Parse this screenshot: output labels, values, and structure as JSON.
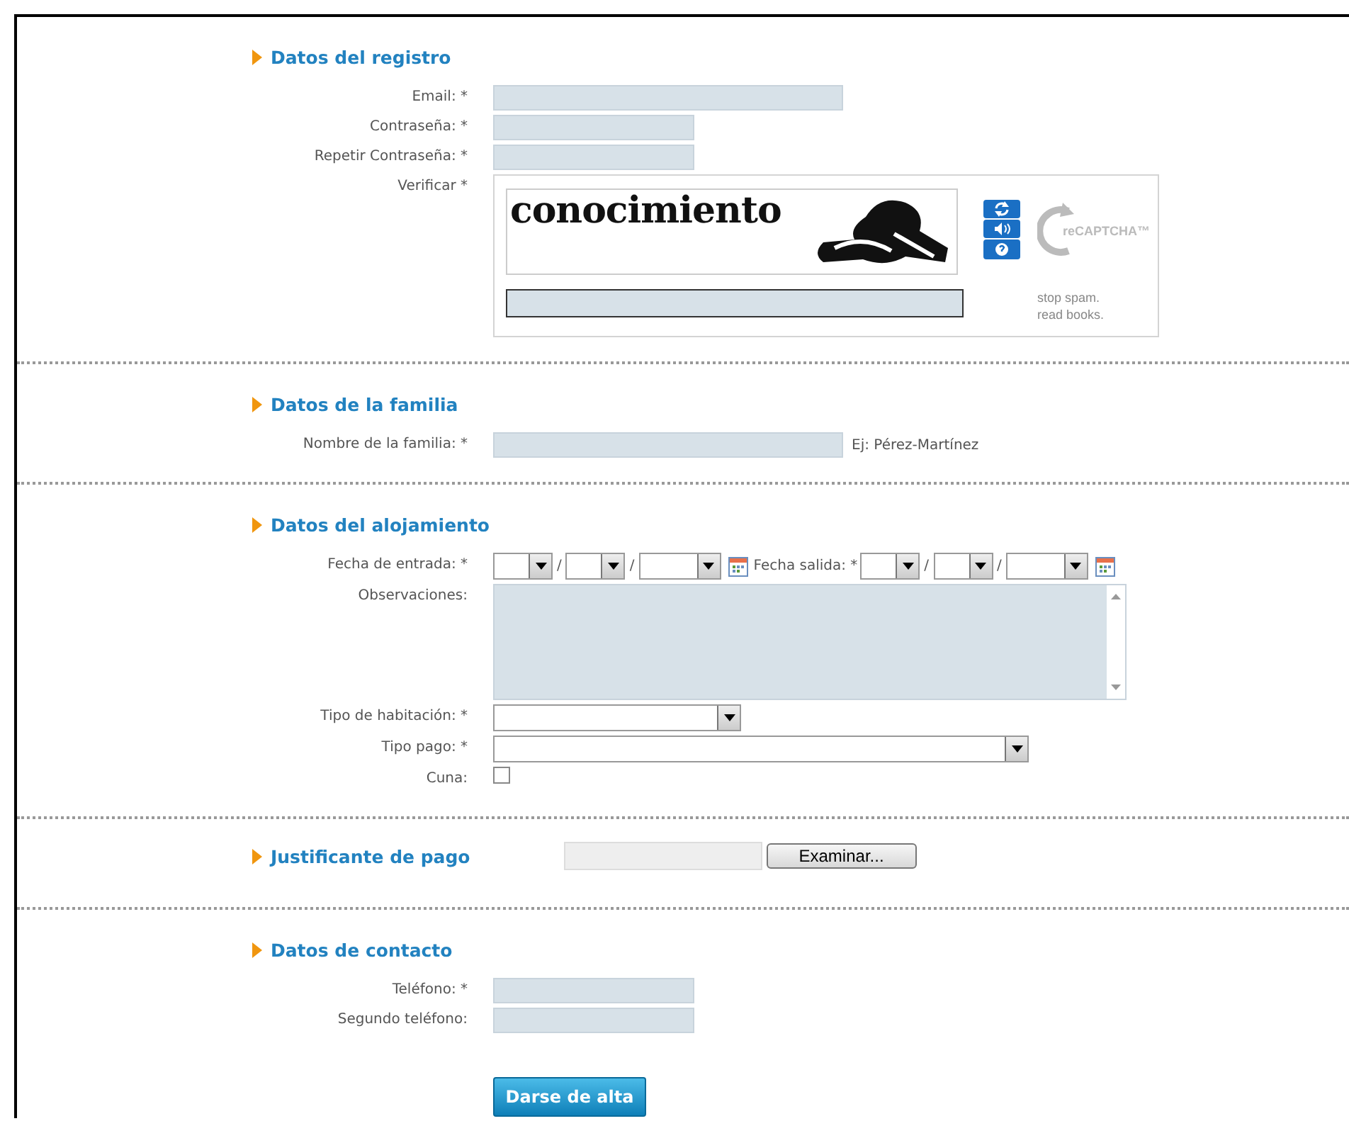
{
  "sections": [
    {
      "title": "Datos del registro",
      "fields": [
        {
          "kind": "email",
          "label": "Email: *"
        },
        {
          "kind": "password",
          "label": "Contraseña: *"
        },
        {
          "kind": "password",
          "label": "Repetir Contraseña: *"
        },
        {
          "kind": "captcha",
          "label": "Verificar *",
          "captcha_word": "conocimiento",
          "logo": "reCAPTCHA™",
          "slogan": "stop spam.\nread books."
        }
      ]
    },
    {
      "title": "Datos de la familia",
      "fields": [
        {
          "kind": "text_hint",
          "label": "Nombre de la familia: *",
          "hint": "Ej: Pérez-Martínez"
        }
      ]
    },
    {
      "title": "Datos del alojamiento",
      "fields": [
        {
          "kind": "date_range",
          "label": "Fecha de entrada: *",
          "separator": "/",
          "second_label": "Fecha salida: *"
        },
        {
          "kind": "textarea",
          "label": "Observaciones:"
        },
        {
          "kind": "select_short",
          "label": "Tipo de habitación: *"
        },
        {
          "kind": "select_long",
          "label": "Tipo pago: *"
        },
        {
          "kind": "checkbox",
          "label": "Cuna:",
          "checked": false
        }
      ]
    },
    {
      "title": "Justificante de pago",
      "file_button": "Examinar..."
    },
    {
      "title": "Datos de contacto",
      "fields": [
        {
          "kind": "phone",
          "label": "Teléfono: *"
        },
        {
          "kind": "phone",
          "label": "Segundo teléfono:"
        }
      ]
    }
  ],
  "submit": "Darse de alta"
}
